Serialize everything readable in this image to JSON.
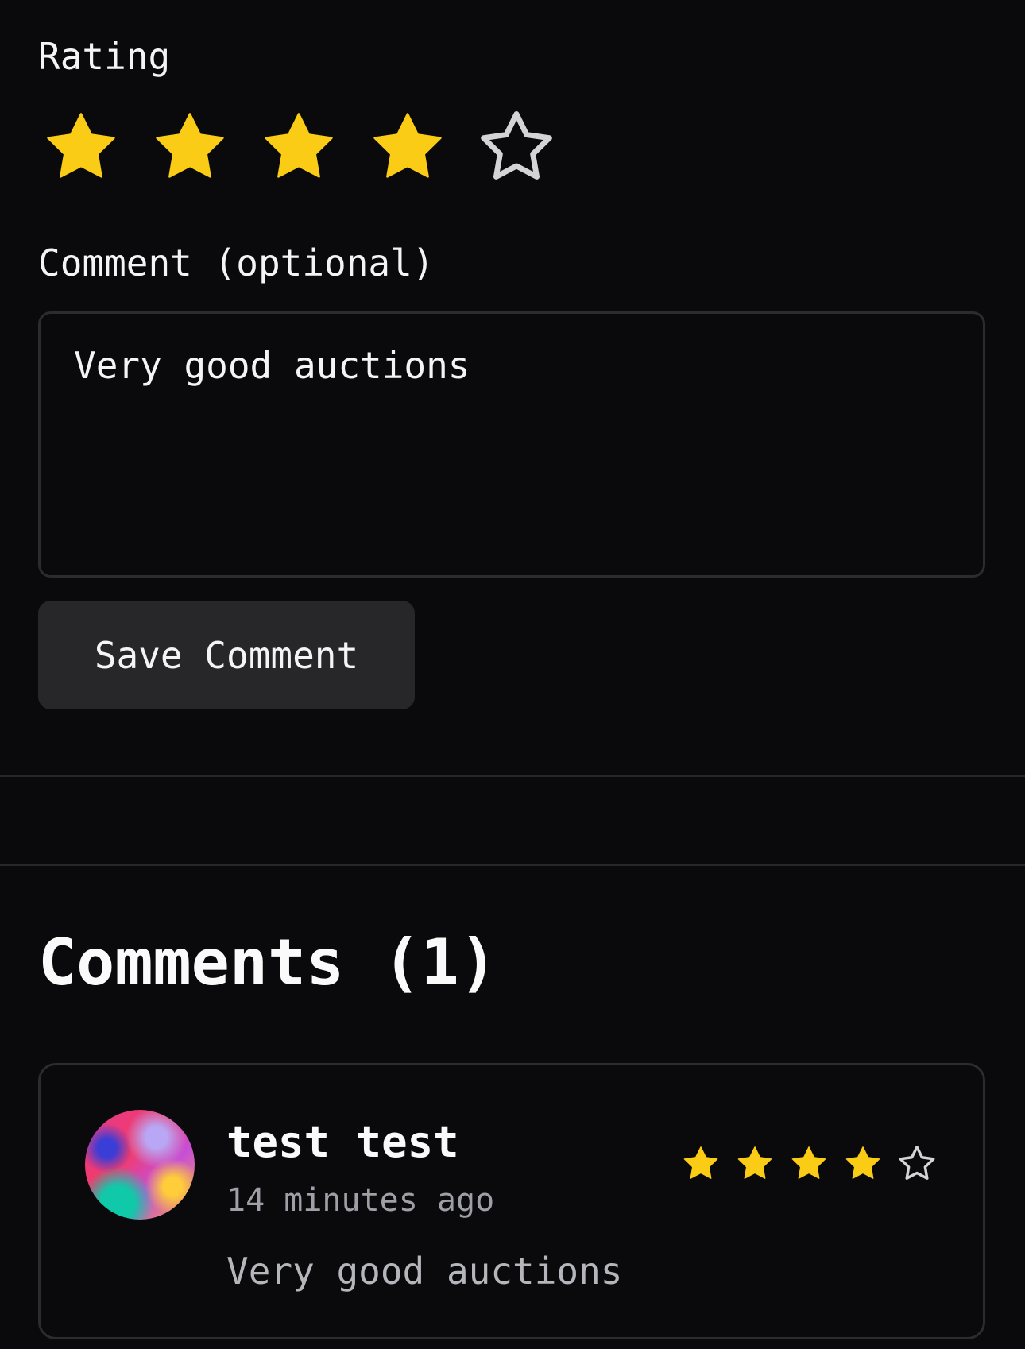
{
  "rating_form": {
    "label": "Rating",
    "value": 4,
    "max": 5
  },
  "comment_form": {
    "label": "Comment (optional)",
    "value": "Very good auctions",
    "save_label": "Save Comment"
  },
  "comments": {
    "title": "Comments (1)",
    "items": [
      {
        "author": "test test",
        "time": "14 minutes ago",
        "rating": 4,
        "max": 5,
        "text": "Very good auctions"
      }
    ]
  },
  "colors": {
    "background": "#0a0a0c",
    "star_filled": "#facc15",
    "star_empty_outline": "#d4d4d8",
    "button_bg": "#27272a",
    "border": "#2b2b30"
  },
  "icons": {
    "filled_star": "star-filled-icon",
    "empty_star": "star-outline-icon"
  }
}
